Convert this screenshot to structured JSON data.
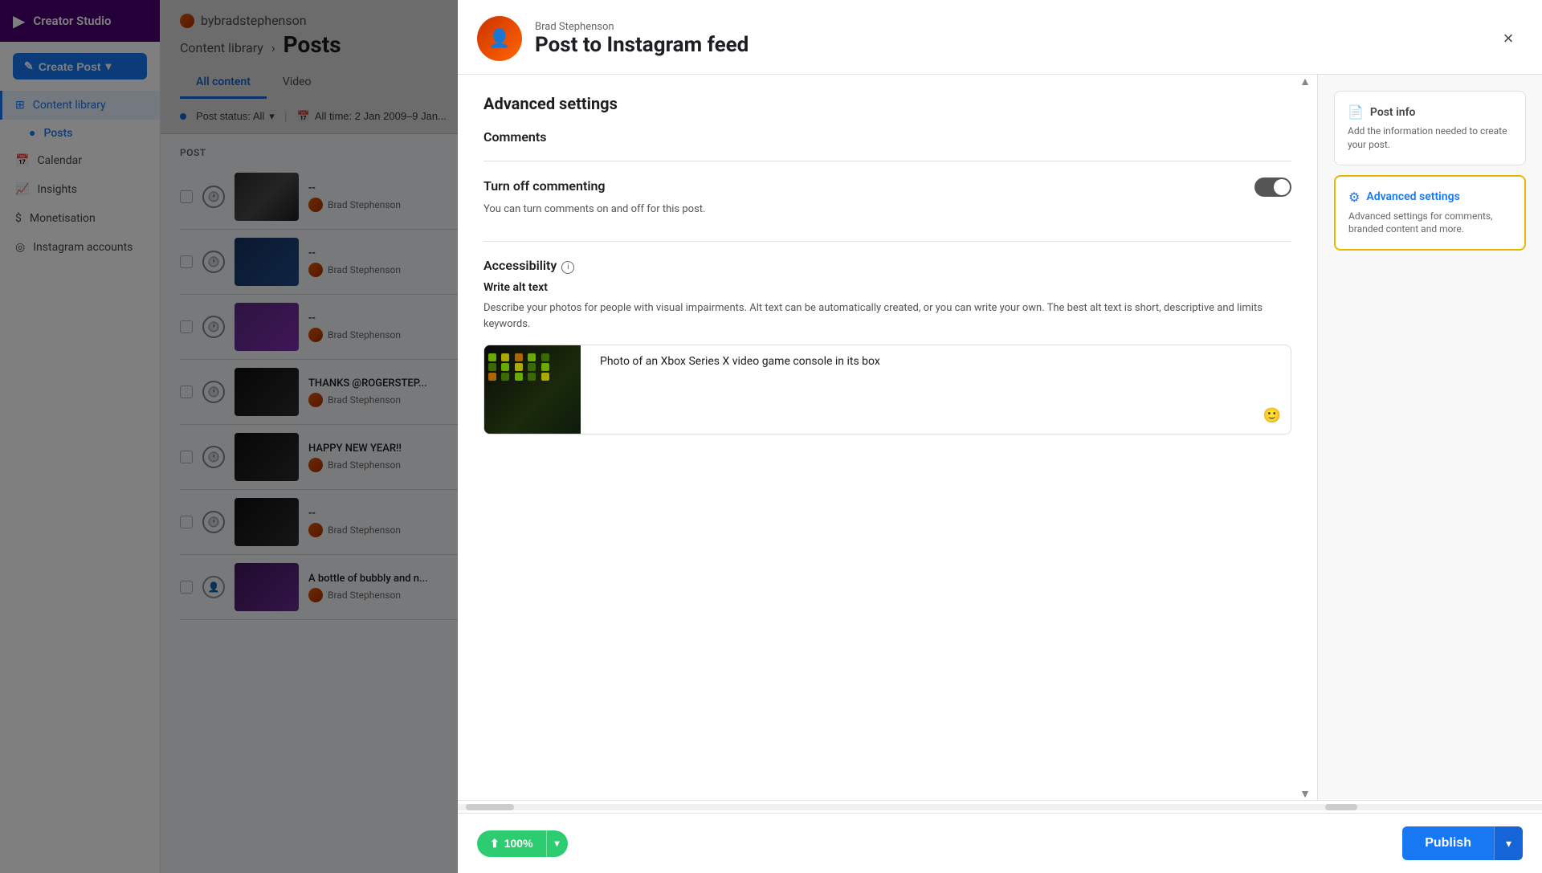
{
  "sidebar": {
    "app_name": "Creator Studio",
    "create_btn": "Create Post",
    "nav_items": [
      {
        "id": "content-library",
        "label": "Content library",
        "active": true
      },
      {
        "id": "posts",
        "label": "Posts",
        "active": true,
        "sub": true
      },
      {
        "id": "calendar",
        "label": "Calendar",
        "active": false
      },
      {
        "id": "insights",
        "label": "Insights",
        "active": false
      },
      {
        "id": "monetisation",
        "label": "Monetisation",
        "active": false
      },
      {
        "id": "instagram-accounts",
        "label": "Instagram accounts",
        "active": false
      }
    ]
  },
  "main": {
    "breadcrumb": "Content library",
    "page_title": "Posts",
    "tabs": [
      "All content",
      "Video"
    ],
    "filters": {
      "status_label": "Post status: All",
      "date_label": "All time: 2 Jan 2009–9 Jan..."
    },
    "table_header": "Post",
    "posts": [
      {
        "id": 1,
        "title": "--",
        "author": "Brad Stephenson",
        "type": "scheduled"
      },
      {
        "id": 2,
        "title": "--",
        "author": "Brad Stephenson",
        "type": "scheduled"
      },
      {
        "id": 3,
        "title": "--",
        "author": "Brad Stephenson",
        "type": "scheduled"
      },
      {
        "id": 4,
        "title": "THANKS @ROGERSTEP...",
        "author": "Brad Stephenson",
        "type": "scheduled"
      },
      {
        "id": 5,
        "title": "HAPPY NEW YEAR!!",
        "author": "Brad Stephenson",
        "type": "scheduled"
      },
      {
        "id": 6,
        "title": "--",
        "author": "Brad Stephenson",
        "type": "scheduled"
      },
      {
        "id": 7,
        "title": "A bottle of bubbly and n...",
        "author": "Brad Stephenson",
        "type": "other"
      }
    ]
  },
  "modal": {
    "user_name": "Brad Stephenson",
    "title": "Post to Instagram feed",
    "close_label": "×",
    "section_title": "Advanced settings",
    "comments_title": "Comments",
    "toggle_label": "Turn off commenting",
    "toggle_desc": "You can turn comments on and off for this post.",
    "accessibility_title": "Accessibility",
    "alt_text_label": "Write alt text",
    "alt_text_desc": "Describe your photos for people with visual impairments. Alt text can be automatically created, or you can write your own. The best alt text is short, descriptive and limits keywords.",
    "alt_text_value": "Photo of an Xbox Series X video game console in its box",
    "sidebar": {
      "post_info_title": "Post info",
      "post_info_desc": "Add the information needed to create your post.",
      "advanced_settings_title": "Advanced settings",
      "advanced_settings_desc": "Advanced settings for comments, branded content and more."
    },
    "footer": {
      "progress_label": "100%",
      "publish_label": "Publish"
    }
  }
}
